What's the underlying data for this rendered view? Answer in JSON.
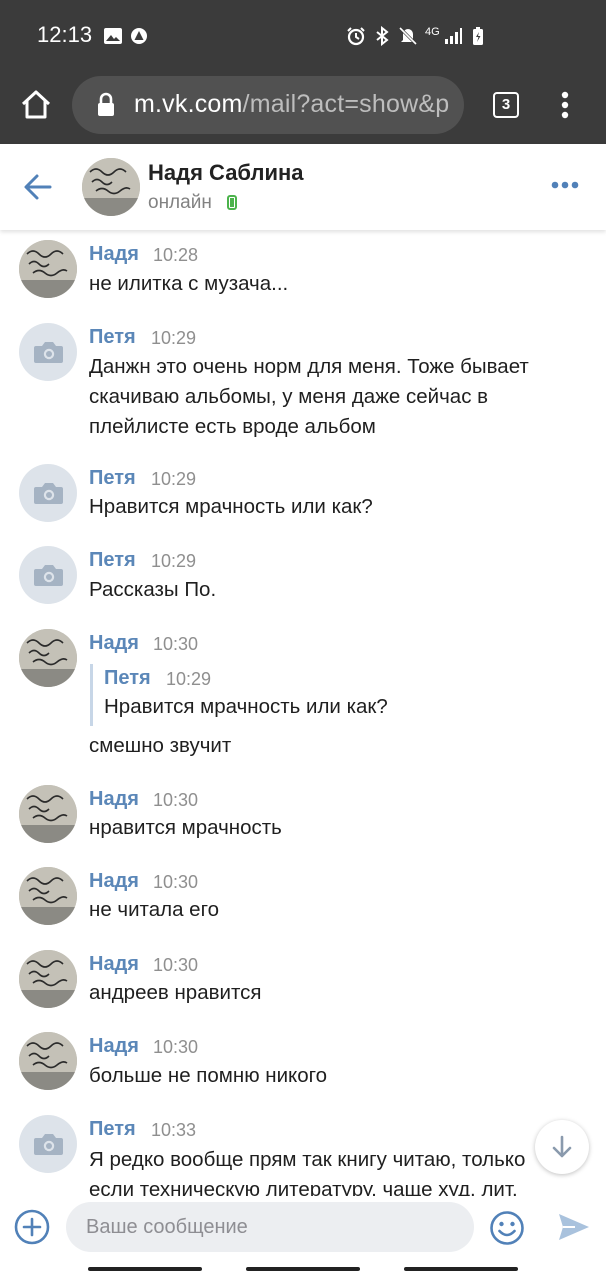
{
  "status_bar": {
    "time": "12:13",
    "network": "4G"
  },
  "browser": {
    "url_host": "m.vk.com",
    "url_path": "/mail?act=show&p",
    "tab_count": "3"
  },
  "chat": {
    "name": "Надя Саблина",
    "status": "онлайн"
  },
  "messages": [
    {
      "author": "Надя",
      "time": "10:28",
      "text": "не илитка с музача..."
    },
    {
      "author": "Петя",
      "time": "10:29",
      "text": "Данжн это очень норм для меня. Тоже бывает скачиваю альбомы, у меня даже сейчас в плейлисте есть вроде альбом"
    },
    {
      "author": "Петя",
      "time": "10:29",
      "text": "Нравится мрачность или как?"
    },
    {
      "author": "Петя",
      "time": "10:29",
      "text": "Рассказы По."
    },
    {
      "author": "Надя",
      "time": "10:30",
      "text": "смешно звучит",
      "quote": {
        "author": "Петя",
        "time": "10:29",
        "text": "Нравится мрачность или как?"
      }
    },
    {
      "author": "Надя",
      "time": "10:30",
      "text": "нравится мрачность"
    },
    {
      "author": "Надя",
      "time": "10:30",
      "text": "не читала его"
    },
    {
      "author": "Надя",
      "time": "10:30",
      "text": "андреев нравится"
    },
    {
      "author": "Надя",
      "time": "10:30",
      "text": "больше не помню никого"
    },
    {
      "author": "Петя",
      "time": "10:33",
      "text": "Я редко вообще прям так книгу читаю, только если техническую литературу, чаще худ. лит."
    }
  ],
  "compose": {
    "placeholder": "Ваше сообщение"
  },
  "icons": {
    "back": "arrow-left-icon",
    "menu": "more-dots-icon",
    "camera": "camera-icon",
    "add": "plus-circle-icon",
    "emoji": "smile-icon",
    "send": "send-icon",
    "scroll": "arrow-down-icon"
  },
  "colors": {
    "accent": "#5181b8",
    "online": "#4bb34b",
    "author": "#5b87b8"
  }
}
